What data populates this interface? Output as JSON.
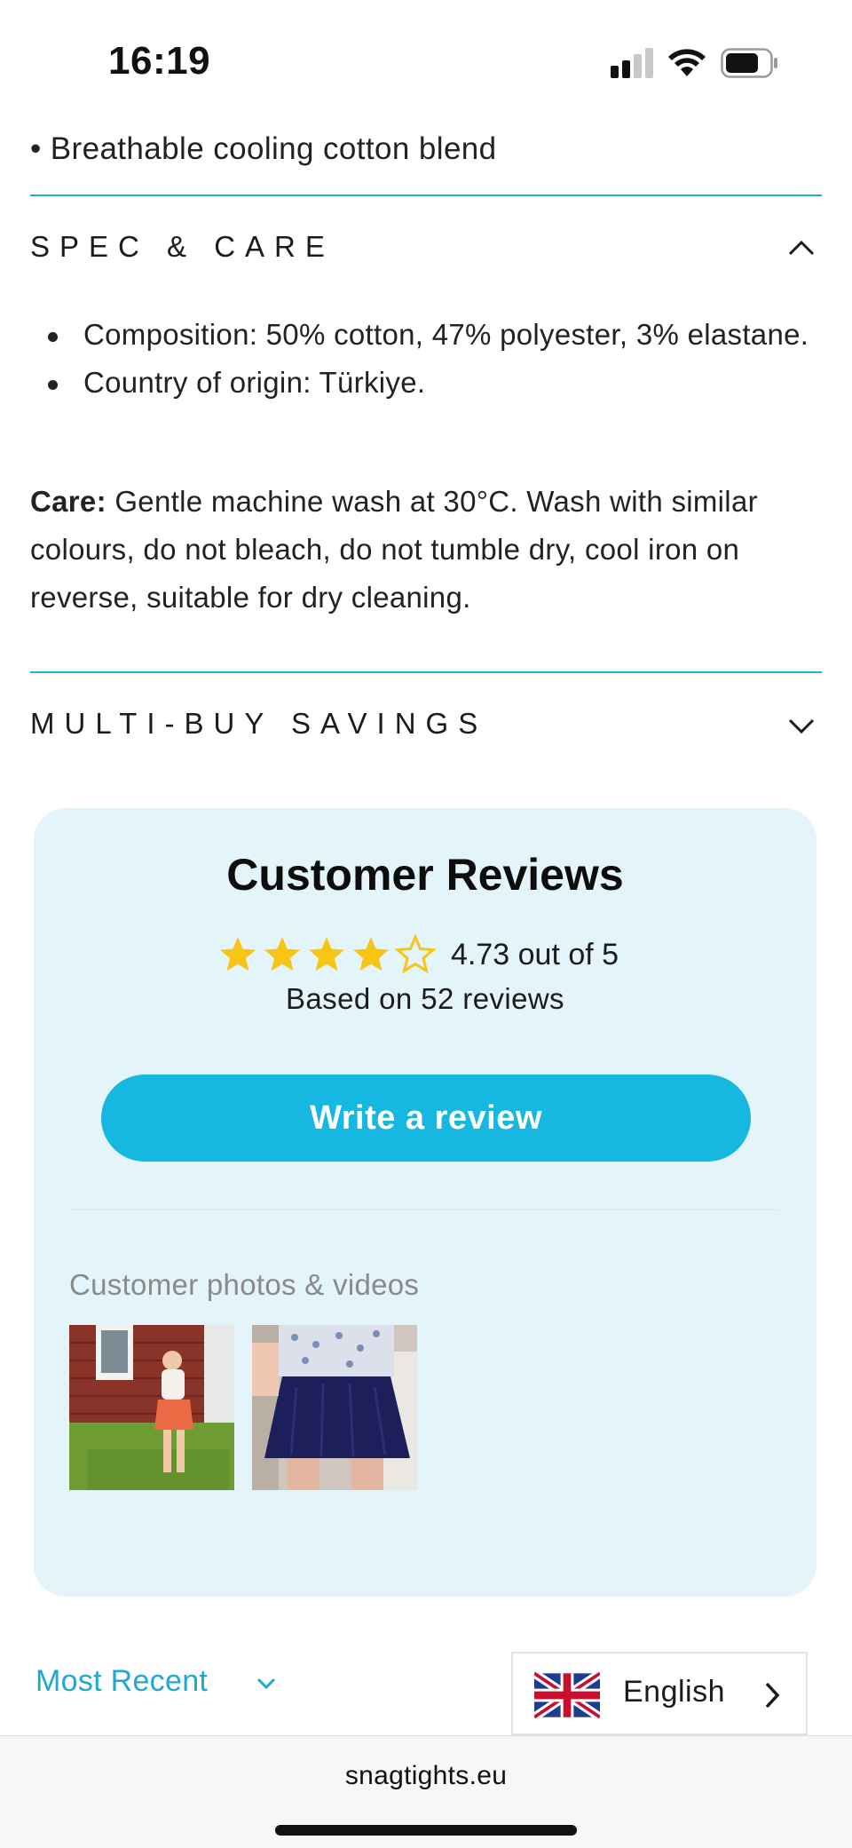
{
  "status_bar": {
    "time": "16:19"
  },
  "product_details": {
    "last_feature": "• Breathable cooling cotton blend"
  },
  "accordions": {
    "spec_care": {
      "title": "SPEC & CARE",
      "expanded": true,
      "bullets": [
        "Composition: 50% cotton, 47% polyester, 3% elastane.",
        "Country of origin: Türkiye."
      ],
      "care_label": "Care:",
      "care_text": "Gentle machine wash at 30°C. Wash with similar colours, do not bleach, do not tumble dry, cool iron on reverse, suitable for dry cleaning."
    },
    "multi_buy": {
      "title": "MULTI-BUY SAVINGS",
      "expanded": false
    }
  },
  "reviews": {
    "title": "Customer Reviews",
    "rating_value": 4.73,
    "rating_text": "4.73 out of 5",
    "based_on": "Based on 52 reviews",
    "write_button": "Write a review",
    "photos_label": "Customer photos & videos",
    "star_color": "#f7c514",
    "photos": [
      {
        "name": "customer-photo-orange-skirt"
      },
      {
        "name": "customer-photo-navy-skirt"
      }
    ]
  },
  "sort": {
    "label": "Most Recent"
  },
  "language_selector": {
    "label": "English",
    "flag_icon": "uk-flag-icon"
  },
  "browser": {
    "url": "snagtights.eu"
  },
  "colors": {
    "accent": "#16b7e0",
    "card_background": "#e3f4fb",
    "divider": "#1db3d9"
  }
}
